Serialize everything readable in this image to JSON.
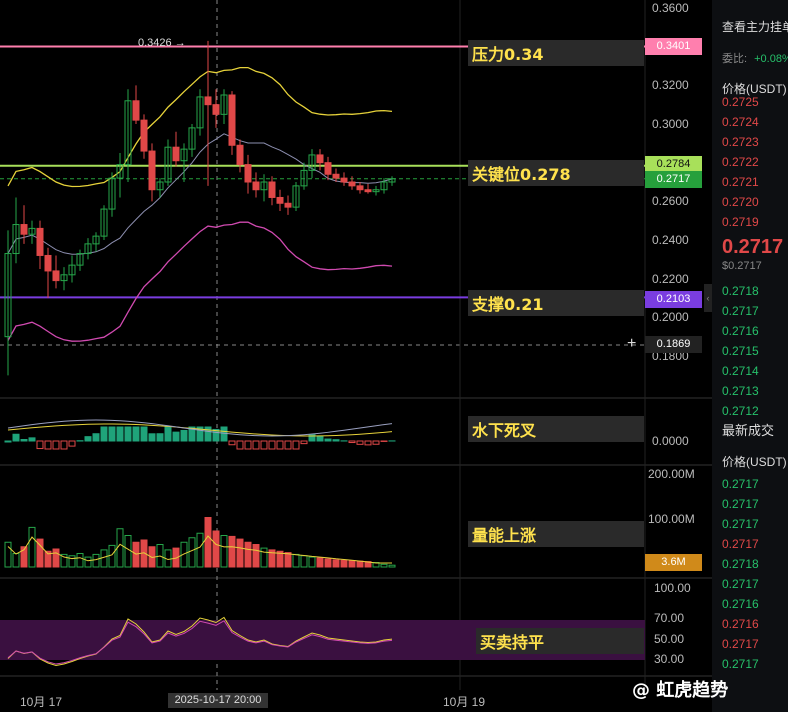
{
  "chart_data": {
    "type": "candlestick",
    "price_axis": {
      "min": 0.16,
      "max": 0.36,
      "ticks": [
        "0.3600",
        "0.3400",
        "0.3200",
        "0.3000",
        "0.2800",
        "0.2600",
        "0.2400",
        "0.2200",
        "0.2000",
        "0.1800"
      ]
    },
    "x_labels": [
      "10月 17",
      "10月 19"
    ],
    "crosshair_label": "2025-10-17 20:00",
    "crosshair_price": "0.1869",
    "high_marker": "0.3426",
    "price_lines": [
      {
        "label": "0.3401",
        "value": 0.3401,
        "color": "#ff7fae",
        "annotation": "压力0.34"
      },
      {
        "label": "0.2784",
        "value": 0.2784,
        "color": "#a8e05a",
        "annotation": "关键位0.278"
      },
      {
        "label": "0.2717",
        "value": 0.2717,
        "color": "#26a03c",
        "annotation": ""
      },
      {
        "label": "0.2103",
        "value": 0.2103,
        "color": "#7a3de0",
        "annotation": "支撑0.21"
      }
    ],
    "candles": [
      [
        0.19,
        0.245,
        0.17,
        0.233
      ],
      [
        0.233,
        0.262,
        0.228,
        0.248
      ],
      [
        0.248,
        0.258,
        0.238,
        0.243
      ],
      [
        0.243,
        0.25,
        0.238,
        0.246
      ],
      [
        0.246,
        0.25,
        0.225,
        0.232
      ],
      [
        0.232,
        0.236,
        0.21,
        0.224
      ],
      [
        0.224,
        0.232,
        0.215,
        0.219
      ],
      [
        0.219,
        0.226,
        0.214,
        0.222
      ],
      [
        0.222,
        0.232,
        0.218,
        0.227
      ],
      [
        0.227,
        0.235,
        0.224,
        0.233
      ],
      [
        0.233,
        0.241,
        0.23,
        0.238
      ],
      [
        0.238,
        0.244,
        0.234,
        0.242
      ],
      [
        0.242,
        0.258,
        0.24,
        0.256
      ],
      [
        0.256,
        0.275,
        0.252,
        0.272
      ],
      [
        0.272,
        0.285,
        0.262,
        0.279
      ],
      [
        0.279,
        0.318,
        0.27,
        0.312
      ],
      [
        0.312,
        0.32,
        0.3,
        0.302
      ],
      [
        0.302,
        0.305,
        0.282,
        0.286
      ],
      [
        0.286,
        0.29,
        0.26,
        0.266
      ],
      [
        0.266,
        0.272,
        0.262,
        0.27
      ],
      [
        0.27,
        0.292,
        0.268,
        0.288
      ],
      [
        0.288,
        0.296,
        0.278,
        0.281
      ],
      [
        0.281,
        0.29,
        0.27,
        0.287
      ],
      [
        0.287,
        0.3,
        0.283,
        0.298
      ],
      [
        0.298,
        0.318,
        0.294,
        0.314
      ],
      [
        0.314,
        0.343,
        0.268,
        0.31
      ],
      [
        0.31,
        0.318,
        0.298,
        0.305
      ],
      [
        0.305,
        0.318,
        0.3,
        0.315
      ],
      [
        0.315,
        0.317,
        0.284,
        0.289
      ],
      [
        0.289,
        0.292,
        0.275,
        0.279
      ],
      [
        0.279,
        0.284,
        0.264,
        0.27
      ],
      [
        0.27,
        0.275,
        0.262,
        0.266
      ],
      [
        0.266,
        0.274,
        0.26,
        0.27
      ],
      [
        0.27,
        0.273,
        0.258,
        0.262
      ],
      [
        0.262,
        0.266,
        0.255,
        0.259
      ],
      [
        0.259,
        0.263,
        0.253,
        0.257
      ],
      [
        0.257,
        0.27,
        0.255,
        0.268
      ],
      [
        0.268,
        0.28,
        0.266,
        0.276
      ],
      [
        0.276,
        0.287,
        0.272,
        0.284
      ],
      [
        0.284,
        0.287,
        0.276,
        0.28
      ],
      [
        0.28,
        0.283,
        0.271,
        0.274
      ],
      [
        0.274,
        0.277,
        0.27,
        0.272
      ],
      [
        0.272,
        0.275,
        0.268,
        0.27
      ],
      [
        0.27,
        0.273,
        0.266,
        0.268
      ],
      [
        0.268,
        0.27,
        0.264,
        0.266
      ],
      [
        0.266,
        0.269,
        0.264,
        0.265
      ],
      [
        0.265,
        0.268,
        0.263,
        0.266
      ],
      [
        0.266,
        0.272,
        0.264,
        0.27
      ],
      [
        0.27,
        0.273,
        0.268,
        0.2717
      ]
    ],
    "macd": {
      "label": "水下死叉",
      "zero_label": "0.0000"
    },
    "volume": {
      "label": "量能上涨",
      "ticks": [
        "200.00M",
        "100.00M"
      ],
      "current": "3.6M",
      "values": [
        55,
        30,
        45,
        88,
        62,
        35,
        40,
        28,
        25,
        30,
        22,
        28,
        38,
        48,
        85,
        70,
        55,
        60,
        45,
        50,
        38,
        42,
        55,
        65,
        75,
        110,
        80,
        70,
        68,
        62,
        55,
        50,
        42,
        38,
        35,
        32,
        28,
        25,
        22,
        20,
        18,
        16,
        15,
        14,
        13,
        12,
        10,
        6,
        4
      ]
    },
    "rsi": {
      "label": "买卖持平",
      "ticks": [
        "100.00",
        "70.00",
        "50.00",
        "30.00"
      ]
    }
  },
  "sidebar": {
    "title": "查看主力挂单",
    "ratio_label": "委比:",
    "ratio_value": "+0.08%",
    "price_header": "价格(USDT)",
    "asks": [
      "0.2725",
      "0.2724",
      "0.2723",
      "0.2722",
      "0.2721",
      "0.2720",
      "0.2719"
    ],
    "last_price": "0.2717",
    "last_price_sub": "$0.2717",
    "bids": [
      "0.2718",
      "0.2717",
      "0.2716",
      "0.2715",
      "0.2714",
      "0.2713",
      "0.2712"
    ],
    "trades_title": "最新成交",
    "trades_header": "价格(USDT)",
    "trades": [
      "0.2717",
      "0.2717",
      "0.2717",
      "0.2717",
      "0.2718",
      "0.2717",
      "0.2716",
      "0.2716",
      "0.2717",
      "0.2717"
    ],
    "trade_colors": [
      "g",
      "g",
      "g",
      "r",
      "g",
      "g",
      "g",
      "r",
      "r",
      "g"
    ]
  },
  "colors": {
    "up": "#26a64a",
    "down": "#e04848"
  },
  "footer": {
    "brand": "@ 虹虎趋势",
    "watermark": "虹虎"
  }
}
